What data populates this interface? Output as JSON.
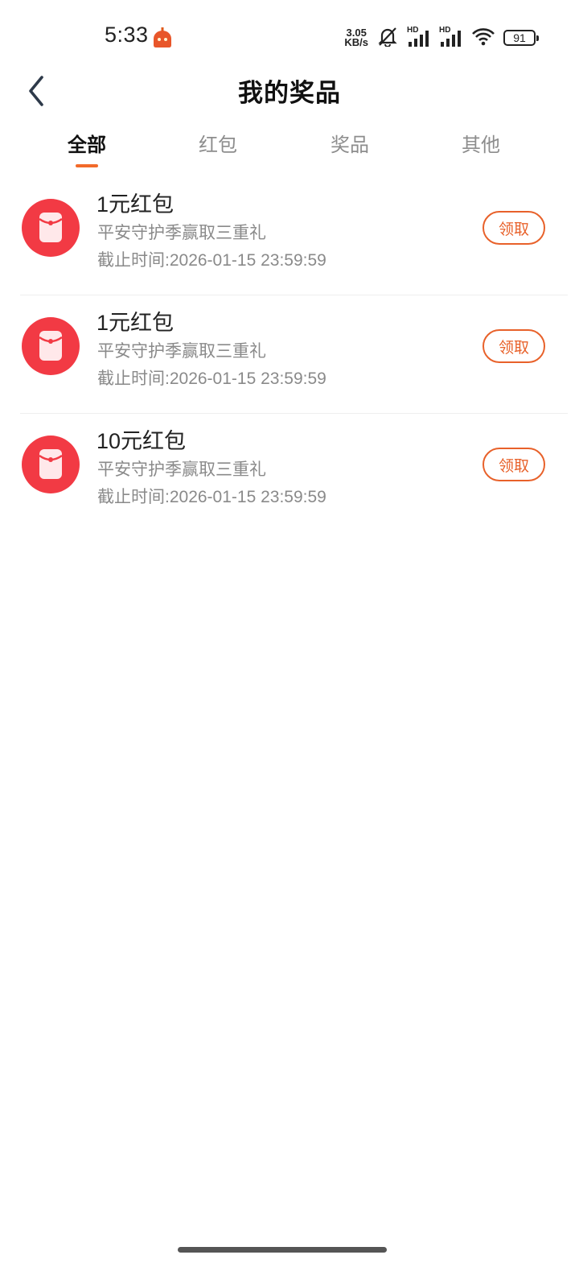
{
  "status_bar": {
    "time": "5:33",
    "net_speed_value": "3.05",
    "net_speed_unit": "KB/s",
    "signal_1_label": "HD",
    "signal_2_label": "HD",
    "battery": "91",
    "icons": [
      "robot-app-icon",
      "mute-bell-icon",
      "signal-icon",
      "signal-icon",
      "wifi-icon",
      "battery-icon"
    ]
  },
  "header": {
    "title": "我的奖品",
    "back_icon": "chevron-left-icon"
  },
  "tabs": [
    {
      "label": "全部",
      "active": true
    },
    {
      "label": "红包",
      "active": false
    },
    {
      "label": "奖品",
      "active": false
    },
    {
      "label": "其他",
      "active": false
    }
  ],
  "prizes": [
    {
      "name": "1元红包",
      "description": "平安守护季赢取三重礼",
      "deadline": "截止时间:2026-01-15 23:59:59",
      "action": "领取",
      "icon": "red-envelope-icon"
    },
    {
      "name": "1元红包",
      "description": "平安守护季赢取三重礼",
      "deadline": "截止时间:2026-01-15 23:59:59",
      "action": "领取",
      "icon": "red-envelope-icon"
    },
    {
      "name": "10元红包",
      "description": "平安守护季赢取三重礼",
      "deadline": "截止时间:2026-01-15 23:59:59",
      "action": "领取",
      "icon": "red-envelope-icon"
    }
  ],
  "colors": {
    "accent": "#e8612a",
    "tab_indicator": "#f26a2a",
    "envelope_red": "#f23a44"
  }
}
